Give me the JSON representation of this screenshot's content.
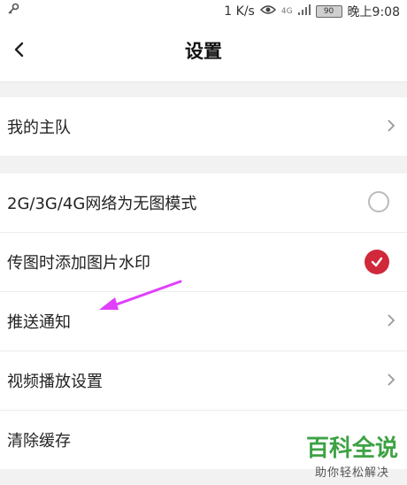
{
  "status_bar": {
    "net_speed": "1 K/s",
    "network_type": "4G",
    "battery": "90",
    "time": "晚上9:08",
    "left_icon": "key-icon",
    "eye_icon": "eye-icon",
    "signal_icon": "signal-icon"
  },
  "header": {
    "title": "设置",
    "back_icon": "chevron-left-icon"
  },
  "sections": [
    {
      "rows": [
        {
          "label": "我的主队",
          "control": "chevron"
        }
      ]
    },
    {
      "rows": [
        {
          "label": "2G/3G/4G网络为无图模式",
          "control": "radio",
          "checked": false
        },
        {
          "label": "传图时添加图片水印",
          "control": "check",
          "checked": true
        },
        {
          "label": "推送通知",
          "control": "chevron"
        },
        {
          "label": "视频播放设置",
          "control": "chevron"
        },
        {
          "label": "清除缓存",
          "control": "none"
        }
      ]
    }
  ],
  "watermark": {
    "main": "百科全说",
    "sub": "助你轻松解决"
  },
  "colors": {
    "accent_red": "#d0293a",
    "annotation_arrow": "#e040fb",
    "watermark_green": "#3da244"
  }
}
